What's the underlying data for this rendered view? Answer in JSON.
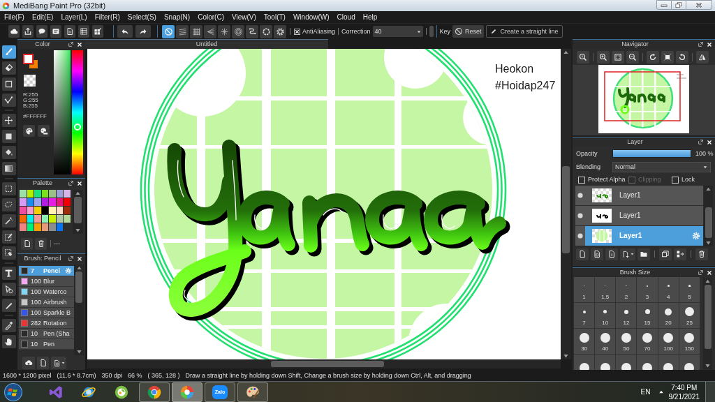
{
  "window": {
    "title": "MediBang Paint Pro (32bit)"
  },
  "menu": [
    "File(F)",
    "Edit(E)",
    "Layer(L)",
    "Filter(R)",
    "Select(S)",
    "Snap(N)",
    "Color(C)",
    "View(V)",
    "Tool(T)",
    "Window(W)",
    "Cloud",
    "Help"
  ],
  "toolbar": {
    "snaps": [
      {
        "selected": true
      },
      {
        "selected": false
      },
      {
        "selected": false
      },
      {
        "selected": false
      },
      {
        "selected": false
      },
      {
        "selected": false
      },
      {
        "selected": false
      },
      {
        "selected": false
      },
      {
        "selected": false
      }
    ],
    "antialiasing": {
      "label": "AntiAliasing",
      "checked": true
    },
    "correction": {
      "label": "Correction",
      "value": "40"
    },
    "key_label": "Key",
    "reset": "Reset",
    "straight_line": "Create a straight line"
  },
  "tools": [
    {
      "selected": true
    },
    {
      "selected": false
    },
    {
      "selected": false
    },
    {
      "selected": false
    },
    {
      "selected": false
    },
    {
      "selected": false
    },
    {
      "selected": false
    },
    {
      "selected": false
    },
    {
      "selected": false
    },
    {
      "selected": false
    },
    {
      "selected": false
    },
    {
      "selected": false
    },
    {
      "selected": false
    },
    {
      "selected": false
    },
    {
      "selected": false
    },
    {
      "selected": false
    },
    {
      "selected": false
    },
    {
      "selected": false
    }
  ],
  "color_panel": {
    "title": "Color",
    "colors": [
      {
        "color": "#ffffff",
        "selected": true
      },
      {
        "color": "#f57f00",
        "selected": false
      }
    ],
    "rgb": [
      "R:255",
      "G:255",
      "B:255"
    ],
    "hex": "#FFFFFF",
    "hue": {
      "level": 0.38
    }
  },
  "palette": {
    "title": "Palette",
    "swatches": [
      {
        "color": "#9de0a8"
      },
      {
        "color": "#b4f000"
      },
      {
        "color": "#19e37a"
      },
      {
        "color": "#7be01e"
      },
      {
        "color": "#9cbf86"
      },
      {
        "color": "#9aa0d6"
      },
      {
        "color": "#d6b4e6"
      },
      {
        "color": "#d49cf2"
      },
      {
        "color": "#1a8cf0"
      },
      {
        "color": "#9aa4f2"
      },
      {
        "color": "#b41ce6"
      },
      {
        "color": "#e61ce6"
      },
      {
        "color": "#e61478"
      },
      {
        "color": "#f00000"
      },
      {
        "color": "#f04fa0"
      },
      {
        "color": "#f59ed2"
      },
      {
        "color": "#f5d000"
      },
      {
        "color": "#000000"
      },
      {
        "color": "#fff2b4"
      },
      {
        "color": "#ffdcc8"
      },
      {
        "color": "#a02d0a"
      },
      {
        "color": "#f06a00"
      },
      {
        "color": "#00f0f0"
      },
      {
        "color": "#f59a9a"
      },
      {
        "color": "#8cf0b4"
      },
      {
        "color": "#c8f000"
      },
      {
        "color": "#b4c8a8"
      },
      {
        "color": "#b4d696"
      },
      {
        "color": "#f08484"
      },
      {
        "color": "#00f078"
      },
      {
        "color": "#f5a000"
      },
      {
        "color": "#e69a78"
      },
      {
        "color": "#8c8c8c"
      },
      {
        "color": "#0a74f0"
      }
    ],
    "label": "---"
  },
  "brush_panel": {
    "title": "Brush: Pencil",
    "brushes": [
      {
        "color": "#2a2a2a",
        "size": "7",
        "name": "Penci",
        "selected": true
      },
      {
        "color": "#f5a6f5",
        "size": "100",
        "name": "Blur",
        "selected": false
      },
      {
        "color": "#7fd8f5",
        "size": "100",
        "name": "Waterco",
        "selected": false
      },
      {
        "color": "#c8c8c8",
        "size": "100",
        "name": "Airbrush",
        "selected": false
      },
      {
        "color": "#3355ee",
        "size": "100",
        "name": "Sparkle B",
        "selected": false
      },
      {
        "color": "#ee3333",
        "size": "282",
        "name": "Rotation",
        "selected": false
      },
      {
        "color": "#2a2a2a",
        "size": "10",
        "name": "Pen (Sha",
        "selected": false
      },
      {
        "color": "#2a2a2a",
        "size": "10",
        "name": "Pen",
        "selected": false
      }
    ]
  },
  "document": {
    "title": "Untitled",
    "texts": [
      "Heokon",
      "#Hoidap247"
    ]
  },
  "navigator": {
    "title": "Navigator"
  },
  "layer_panel": {
    "title": "Layer",
    "opacity": {
      "label": "Opacity",
      "level": 1,
      "reading": "100 %"
    },
    "blending": {
      "label": "Blending",
      "value": "Normal"
    },
    "options": [
      {
        "label": "Protect Alpha",
        "checked": false,
        "disabled": false
      },
      {
        "label": "Clipping",
        "checked": false,
        "disabled": true
      },
      {
        "label": "Lock",
        "checked": false,
        "disabled": false
      }
    ],
    "layers": [
      {
        "name": "Layer1",
        "selected": false,
        "visible": true
      },
      {
        "name": "Layer1",
        "selected": false,
        "visible": true
      },
      {
        "name": "Layer1",
        "selected": true,
        "visible": true
      }
    ]
  },
  "brush_size": {
    "title": "Brush Size",
    "sizes": [
      "1",
      "1.5",
      "2",
      "3",
      "4",
      "5",
      "7",
      "10",
      "12",
      "15",
      "20",
      "25",
      "30",
      "40",
      "50",
      "70",
      "100",
      "150"
    ]
  },
  "status_bar": [
    "1600 * 1200 pixel",
    "(11.6 * 8.7cm)",
    "350 dpi",
    "66 %",
    "( 365, 128 )",
    "Draw a straight line by holding down Shift, Change a brush size by holding down Ctrl, Alt, and dragging"
  ],
  "taskbar": {
    "apps": [
      {
        "running": false,
        "selected": false
      },
      {
        "running": false,
        "selected": false
      },
      {
        "running": false,
        "selected": false
      },
      {
        "running": true,
        "selected": false
      },
      {
        "running": true,
        "selected": true
      },
      {
        "running": true,
        "selected": false,
        "logo_text": "Zalo"
      },
      {
        "running": true,
        "selected": false
      }
    ],
    "language": "EN",
    "time": "7:40 PM",
    "date": "9/21/2021"
  }
}
